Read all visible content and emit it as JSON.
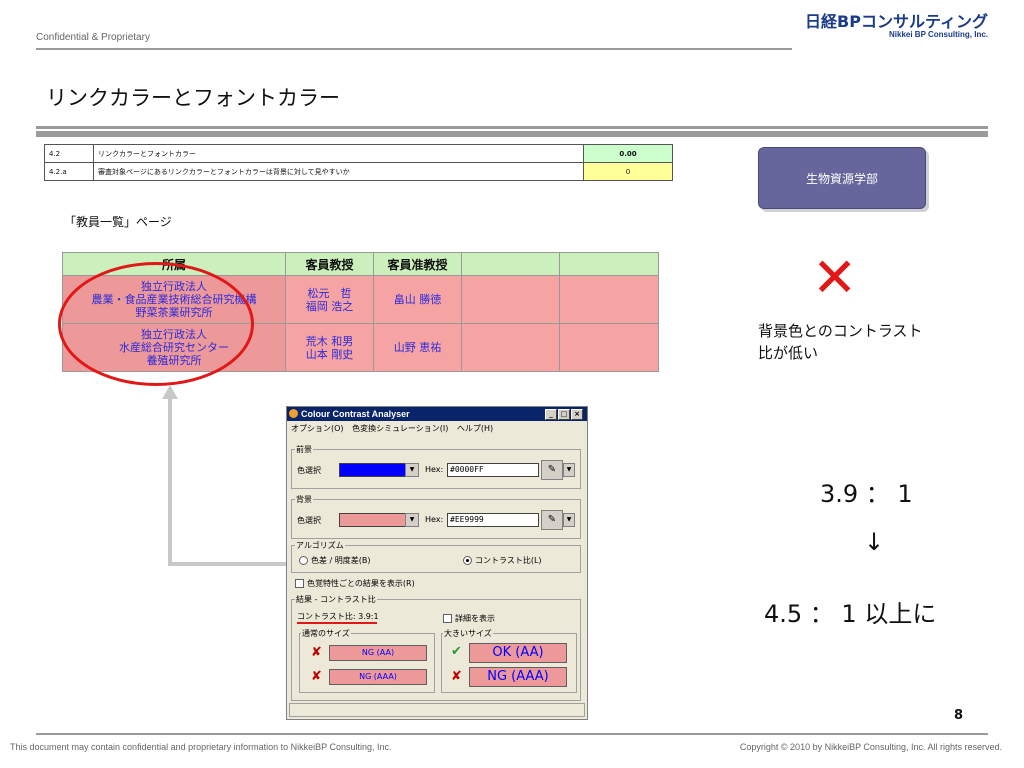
{
  "header": {
    "confidential": "Confidential & Proprietary",
    "logo_main": "日経BPコンサルティング",
    "logo_sub": "Nikkei BP Consulting, Inc."
  },
  "title": "リンクカラーとフォントカラー",
  "criteria": [
    {
      "num": "4.2",
      "desc": "リンクカラーとフォントカラー",
      "value": "0.00"
    },
    {
      "num": "4.2.a",
      "desc": "審査対象ページにあるリンクカラーとフォントカラーは背景に対して見やすいか",
      "value": "0"
    }
  ],
  "department_button": "生物資源学部",
  "page_label": "「教員一覧」ページ",
  "staff_table": {
    "headers": [
      "所属",
      "客員教授",
      "客員准教授",
      "",
      ""
    ],
    "rows": [
      {
        "aff": [
          "独立行政法人",
          "農業・食品産業技術総合研究機構",
          "野菜茶業研究所"
        ],
        "prof": [
          "松元　哲",
          "福岡 浩之"
        ],
        "assoc": "畠山 勝徳"
      },
      {
        "aff": [
          "独立行政法人",
          "水産総合研究センター",
          "養殖研究所"
        ],
        "prof": [
          "荒木 和男",
          "山本 剛史"
        ],
        "assoc": "山野 恵祐"
      }
    ]
  },
  "analysis": {
    "note_line1": "背景色とのコントラスト",
    "note_line2": "比が低い",
    "ratio_current": "3.9 ： 1",
    "arrow": "↓",
    "ratio_target": "4.5 ： 1 以上に"
  },
  "cca": {
    "title": "Colour Contrast Analyser",
    "menu": [
      "オプション(O)",
      "色変換シミュレーション(I)",
      "ヘルプ(H)"
    ],
    "fg_group": "前景",
    "bg_group": "背景",
    "color_select": "色選択",
    "hex_label": "Hex:",
    "fg_hex": "#0000FF",
    "bg_hex": "#EE9999",
    "fg_color": "#0000ff",
    "bg_color": "#ee9999",
    "algo_group": "アルゴリズム",
    "algo_opt1": "色差 / 明度差(B)",
    "algo_opt2": "コントラスト比(L)",
    "show_results": "色覚特性ごとの結果を表示(R)",
    "result_group": "結果 - コントラスト比",
    "contrast_ratio": "コントラスト比: 3.9:1",
    "show_detail": "詳細を表示",
    "normal_size": "通常のサイズ",
    "large_size": "大きいサイズ",
    "normal_aa": "NG (AA)",
    "normal_aaa": "NG (AAA)",
    "large_aa": "OK (AA)",
    "large_aaa": "NG (AAA)"
  },
  "page_number": "8",
  "footer": {
    "left": "This document may contain confidential and proprietary information to NikkeiBP Consulting, Inc.",
    "right": "Copyright © 2010 by NikkeiBP Consulting, Inc. All rights reserved."
  }
}
